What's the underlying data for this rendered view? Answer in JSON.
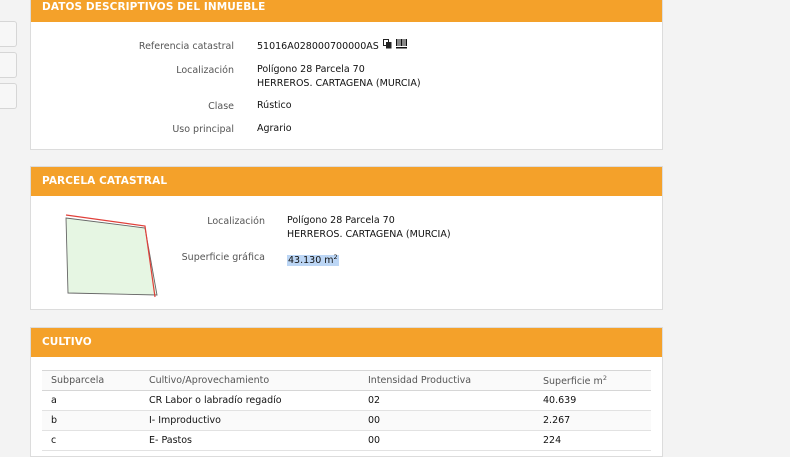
{
  "datos": {
    "title": "DATOS DESCRIPTIVOS DEL INMUEBLE",
    "ref_label": "Referencia catastral",
    "ref_value": "51016A028000700000AS",
    "loc_label": "Localización",
    "loc_line1": "Polígono 28 Parcela 70",
    "loc_line2": "HERREROS. CARTAGENA (MURCIA)",
    "clase_label": "Clase",
    "clase_value": "Rústico",
    "uso_label": "Uso principal",
    "uso_value": "Agrario"
  },
  "parcela": {
    "title": "PARCELA CATASTRAL",
    "loc_label": "Localización",
    "loc_line1": "Polígono 28 Parcela 70",
    "loc_line2": "HERREROS. CARTAGENA (MURCIA)",
    "sup_label": "Superficie gráfica",
    "sup_value": "43.130 m",
    "sup_unit_exp": "2"
  },
  "cultivo": {
    "title": "CULTIVO",
    "headers": [
      "Subparcela",
      "Cultivo/Aprovechamiento",
      "Intensidad Productiva",
      "Superficie m"
    ],
    "header_exp": "2",
    "rows": [
      [
        "a",
        "CR Labor o labradío regadío",
        "02",
        "40.639"
      ],
      [
        "b",
        "I- Improductivo",
        "00",
        "2.267"
      ],
      [
        "c",
        "E- Pastos",
        "00",
        "224"
      ]
    ]
  },
  "colors": {
    "header": "#f4a12a",
    "parcel_fill": "#e6f6e3",
    "parcel_border": "#e0403a",
    "highlight": "#bcd6f5"
  },
  "icons": [
    "copy-icon",
    "barcode-icon"
  ]
}
